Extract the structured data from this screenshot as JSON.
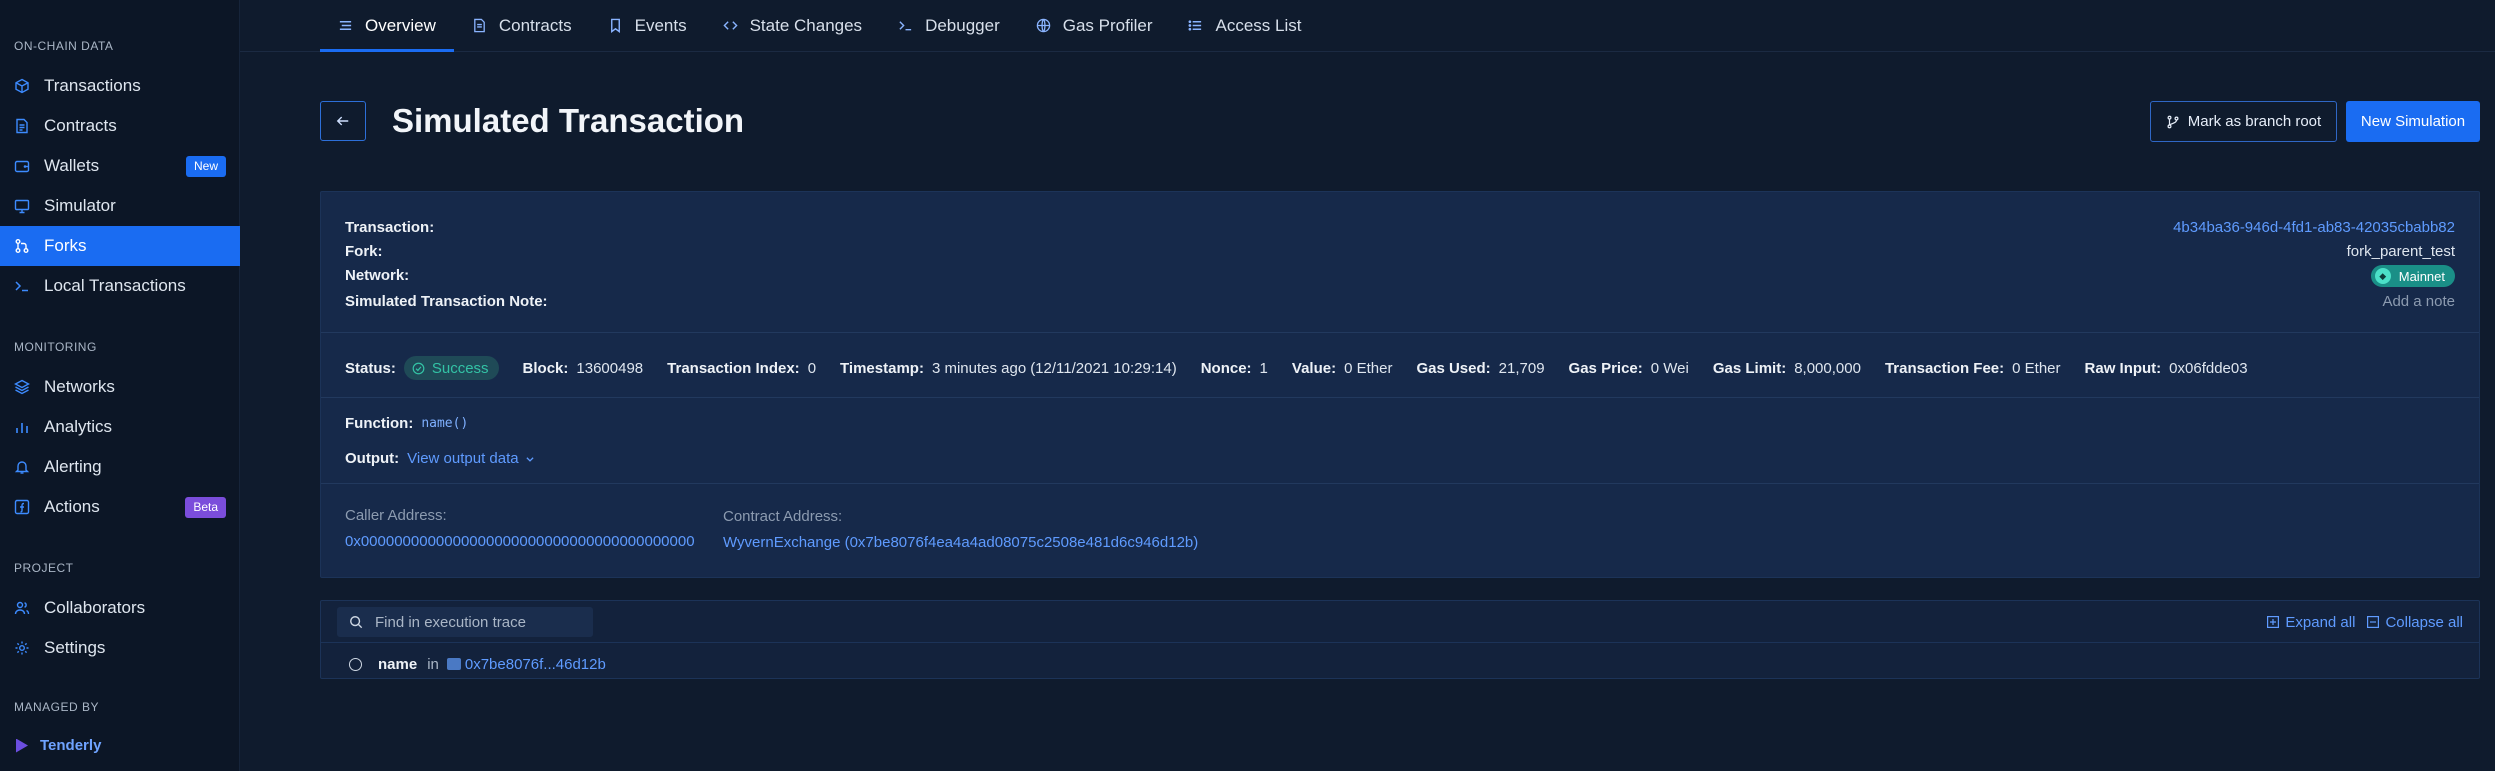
{
  "sidebar": {
    "sections": {
      "on_chain": "ON-CHAIN DATA",
      "monitoring": "MONITORING",
      "project": "PROJECT",
      "managed_by": "MANAGED BY"
    },
    "items": [
      {
        "label": "Transactions",
        "icon": "cube-icon"
      },
      {
        "label": "Contracts",
        "icon": "document-icon"
      },
      {
        "label": "Wallets",
        "icon": "wallet-icon",
        "badge": "New"
      },
      {
        "label": "Simulator",
        "icon": "monitor-icon"
      },
      {
        "label": "Forks",
        "icon": "fork-icon",
        "active": true
      },
      {
        "label": "Local Transactions",
        "icon": "terminal-icon"
      },
      {
        "label": "Networks",
        "icon": "layers-icon"
      },
      {
        "label": "Analytics",
        "icon": "bar-chart-icon"
      },
      {
        "label": "Alerting",
        "icon": "bell-icon"
      },
      {
        "label": "Actions",
        "icon": "function-icon",
        "badge": "Beta"
      },
      {
        "label": "Collaborators",
        "icon": "users-icon"
      },
      {
        "label": "Settings",
        "icon": "gear-icon"
      }
    ],
    "managed_by_name": "Tenderly"
  },
  "tabs": [
    {
      "label": "Overview",
      "icon": "list-icon",
      "active": true
    },
    {
      "label": "Contracts",
      "icon": "document-icon"
    },
    {
      "label": "Events",
      "icon": "bookmark-icon"
    },
    {
      "label": "State Changes",
      "icon": "code-icon"
    },
    {
      "label": "Debugger",
      "icon": "terminal-icon"
    },
    {
      "label": "Gas Profiler",
      "icon": "globe-icon"
    },
    {
      "label": "Access List",
      "icon": "list-icon"
    }
  ],
  "header": {
    "title": "Simulated Transaction",
    "branch_button": "Mark as branch root",
    "new_simulation_button": "New Simulation"
  },
  "details": {
    "transaction_label": "Transaction:",
    "transaction_value": "4b34ba36-946d-4fd1-ab83-42035cbabb82",
    "fork_label": "Fork:",
    "fork_value": "fork_parent_test",
    "network_label": "Network:",
    "network_value": "Mainnet",
    "note_label": "Simulated Transaction Note:",
    "note_action": "Add a note"
  },
  "status": {
    "status_label": "Status:",
    "status_value": "Success",
    "block_label": "Block:",
    "block_value": "13600498",
    "index_label": "Transaction Index:",
    "index_value": "0",
    "timestamp_label": "Timestamp:",
    "timestamp_value": "3 minutes ago",
    "timestamp_full": "(12/11/2021 10:29:14)",
    "nonce_label": "Nonce:",
    "nonce_value": "1",
    "value_label": "Value:",
    "value_value": "0 Ether",
    "gas_used_label": "Gas Used:",
    "gas_used_value": "21,709",
    "gas_price_label": "Gas Price:",
    "gas_price_value": "0 Wei",
    "gas_limit_label": "Gas Limit:",
    "gas_limit_value": "8,000,000",
    "fee_label": "Transaction Fee:",
    "fee_value": "0 Ether",
    "raw_input_label": "Raw Input:",
    "raw_input_value": "0x06fdde03"
  },
  "function": {
    "function_label": "Function:",
    "function_value": "name()",
    "output_label": "Output:",
    "output_link": "View output data"
  },
  "addresses": {
    "caller_label": "Caller Address:",
    "caller_value": "0x0000000000000000000000000000000000000000",
    "contract_label": "Contract Address:",
    "contract_value": "WyvernExchange (0x7be8076f4ea4a4ad08075c2508e481d6c946d12b)"
  },
  "trace": {
    "search_placeholder": "Find in execution trace",
    "expand_all": "Expand all",
    "collapse_all": "Collapse all",
    "row_function": "name",
    "row_in": "in",
    "row_contract": "0x7be8076f...46d12b"
  },
  "colors": {
    "background": "#0f1b2d",
    "sidebar": "#0c1626",
    "accent": "#1a6cf2",
    "link": "#5f9bff",
    "success": "#33c2a5",
    "beta_badge": "#7b4ddb",
    "mainnet": "#1a8f87"
  }
}
